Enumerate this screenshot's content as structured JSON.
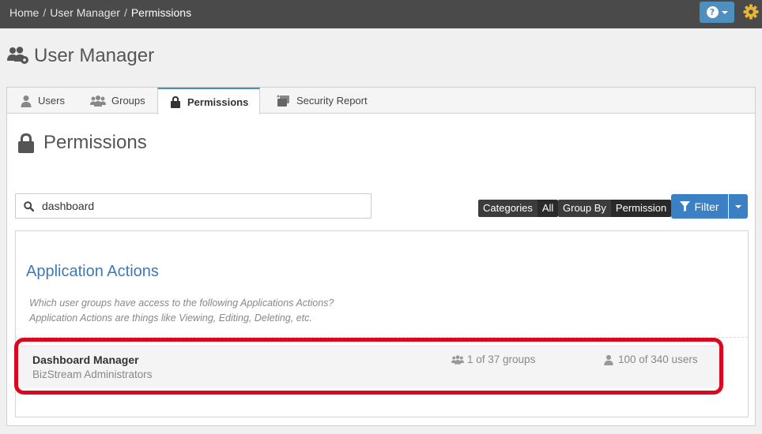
{
  "breadcrumb": {
    "items": [
      "Home",
      "User Manager",
      "Permissions"
    ],
    "separator": "/"
  },
  "topbar": {
    "help_symbol": "?"
  },
  "page": {
    "title": "User Manager"
  },
  "tabs": [
    {
      "label": "Users",
      "icon": "user-icon"
    },
    {
      "label": "Groups",
      "icon": "group-icon"
    },
    {
      "label": "Permissions",
      "icon": "lock-icon",
      "active": true
    },
    {
      "label": "Security Report",
      "icon": "report-icon"
    }
  ],
  "section": {
    "title": "Permissions"
  },
  "search": {
    "value": "dashboard",
    "placeholder": ""
  },
  "filters": {
    "categories": {
      "key": "Categories",
      "value": "All"
    },
    "group_by": {
      "key": "Group By",
      "value": "Permission"
    },
    "filter_label": "Filter"
  },
  "results": {
    "title": "Application Actions",
    "desc_line1": "Which user groups have access to the following Applications Actions?",
    "desc_line2": "Application Actions are things like Viewing, Editing, Deleting, etc.",
    "rows": [
      {
        "name": "Dashboard Manager",
        "subtitle": "BizStream Administrators",
        "groups": "1 of 37 groups",
        "users": "100 of 340 users"
      }
    ]
  },
  "colors": {
    "topbar": "#4a4a4a",
    "accent": "#3b7fc4",
    "heading_link": "#3d7ab5",
    "highlight": "#d8091e",
    "gear": "#e8b437"
  }
}
